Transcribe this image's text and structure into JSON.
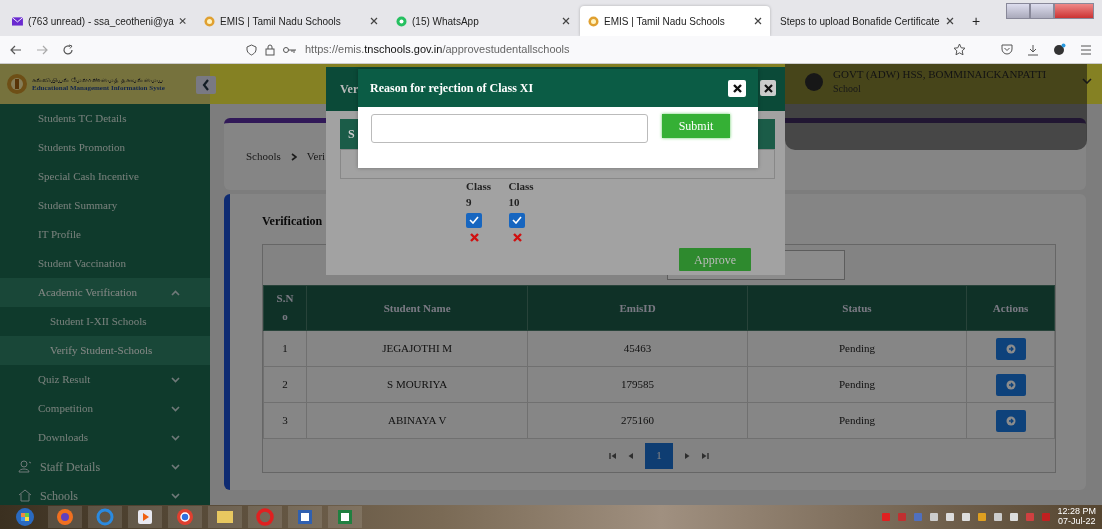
{
  "browser": {
    "tabs": [
      {
        "title": "(763 unread) - ssa_ceotheni@ya",
        "kind": "mail",
        "selected": false
      },
      {
        "title": "EMIS | Tamil Nadu Schools",
        "kind": "emis",
        "selected": false
      },
      {
        "title": "(15) WhatsApp",
        "kind": "whatsapp",
        "selected": false
      },
      {
        "title": "EMIS | Tamil Nadu Schools",
        "kind": "emis",
        "selected": true
      },
      {
        "title": "Steps to upload Bonafide Certificate",
        "kind": "page",
        "selected": false
      }
    ],
    "new_tab": "+",
    "url": {
      "scheme": "https://emis.",
      "domain": "tnschools.gov.in",
      "path": "/approvestudentallschools"
    }
  },
  "header": {
    "logo_tamil": "கல்வியியல் மேலாண்மைத் தகவல் மைய",
    "logo_english": "Educational Management Information Syste",
    "school": "GOVT (ADW) HSS, BOMMINAICKANPATTI",
    "role": "School"
  },
  "sidebar": {
    "items": [
      {
        "label": "Students TC Details",
        "kind": "item",
        "selected": false
      },
      {
        "label": "Students Promotion",
        "kind": "item",
        "selected": false
      },
      {
        "label": "Special Cash Incentive",
        "kind": "item",
        "selected": false
      },
      {
        "label": "Student Summary",
        "kind": "item",
        "selected": false
      },
      {
        "label": "IT Profile",
        "kind": "item",
        "selected": false
      },
      {
        "label": "Student Vaccination",
        "kind": "item",
        "selected": false
      },
      {
        "label": "Academic Verification",
        "kind": "group",
        "selected": true,
        "expanded": true,
        "children": [
          {
            "label": "Student I-XII Schools",
            "selected": false
          },
          {
            "label": "Verify Student-Schools",
            "selected": true
          }
        ]
      },
      {
        "label": "Quiz Result",
        "kind": "group",
        "selected": false,
        "expanded": false
      },
      {
        "label": "Competition",
        "kind": "group",
        "selected": false,
        "expanded": false
      },
      {
        "label": "Downloads",
        "kind": "group",
        "selected": false,
        "expanded": false
      },
      {
        "label": "Staff Details",
        "kind": "staff",
        "selected": false,
        "expanded": false
      },
      {
        "label": "Schools",
        "kind": "home",
        "selected": false,
        "expanded": false
      }
    ]
  },
  "breadcrumb": [
    "Schools",
    "Veri"
  ],
  "panel": {
    "title": "Verification",
    "table": {
      "columns": [
        "S.No",
        "Student Name",
        "EmisID",
        "Status",
        "Actions"
      ],
      "rows": [
        {
          "sno": "1",
          "name": "JEGAJOTHI M",
          "emis_id": "45463",
          "status": "Pending"
        },
        {
          "sno": "2",
          "name": "S MOURIYA",
          "emis_id": "179585",
          "status": "Pending"
        },
        {
          "sno": "3",
          "name": "ABINAYA V",
          "emis_id": "275160",
          "status": "Pending"
        }
      ]
    },
    "pagination": {
      "pages": [
        {
          "label": "1",
          "selected": true
        }
      ]
    }
  },
  "verify_modal": {
    "title": "Ver",
    "column_head": "S",
    "classes": [
      {
        "label": "Class 9",
        "checked": true,
        "rejected": true
      },
      {
        "label": "Class 10",
        "checked": true,
        "rejected": true
      }
    ],
    "approve": "Approve"
  },
  "reject_modal": {
    "title": "Reason for rejection of Class XI",
    "submit": "Submit"
  },
  "taskbar": {
    "time": "12:28 PM",
    "date": "07-Jul-22"
  }
}
